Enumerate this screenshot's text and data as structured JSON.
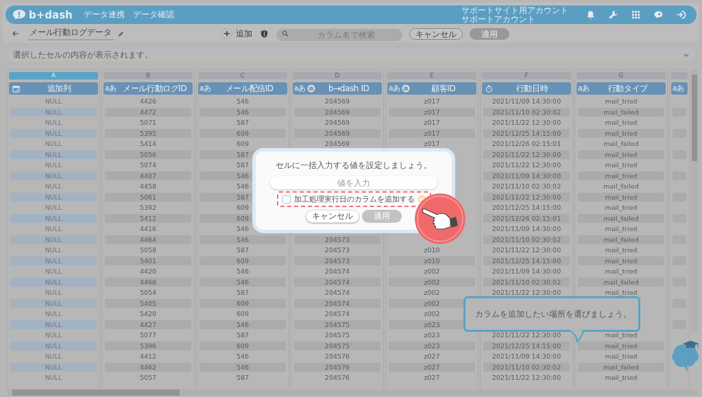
{
  "header": {
    "logo": "b+dash",
    "nav": [
      {
        "label": "データ連携"
      },
      {
        "label": "データ確認"
      }
    ],
    "account": [
      "サポートサイト用アカウント",
      "サポートアカウント"
    ]
  },
  "toolbar": {
    "title": "メール行動ログデータ",
    "add_label": "追加",
    "search": {
      "placeholder": "カラム名で検索"
    },
    "buttons": [
      {
        "label": "キャンセル",
        "disabled": false
      },
      {
        "label": "適用",
        "disabled": true
      }
    ]
  },
  "info_bar": {
    "text": "選択したセルの内容が表示されます。",
    "expanded": false
  },
  "table": {
    "columns": [
      {
        "letter": "A",
        "label": "追加列",
        "kind": "date",
        "selected": true
      },
      {
        "letter": "B",
        "badge": "aあ",
        "label": "メール行動ログID",
        "kind": "text",
        "selected": false
      },
      {
        "letter": "C",
        "badge": "aあ",
        "label": "メール配信ID",
        "kind": "text",
        "selected": false
      },
      {
        "letter": "D",
        "badge": "aあ",
        "label": "b→dash ID",
        "kind": "id",
        "selected": false
      },
      {
        "letter": "E",
        "badge": "aあ",
        "label": "顧客ID",
        "kind": "id",
        "selected": false
      },
      {
        "letter": "F",
        "label": "行動日時",
        "kind": "time",
        "selected": false
      },
      {
        "letter": "G",
        "badge": "aあ",
        "label": "行動タイプ",
        "kind": "text",
        "selected": false
      },
      {
        "badge": "aあ",
        "kind": "text",
        "selected": false
      }
    ],
    "rows": [
      {
        "added": "NULL",
        "log_id": "4426",
        "delivery_id": "546",
        "bdash_id": "204569",
        "customer_id": "z017",
        "acted_at": "2021/11/09 14:30:00",
        "action_type": "mail_tried"
      },
      {
        "added": "NULL",
        "log_id": "4472",
        "delivery_id": "546",
        "bdash_id": "204569",
        "customer_id": "z017",
        "acted_at": "2021/11/10 02:30:02",
        "action_type": "mail_failed"
      },
      {
        "added": "NULL",
        "log_id": "5071",
        "delivery_id": "587",
        "bdash_id": "204569",
        "customer_id": "z017",
        "acted_at": "2021/11/22 12:30:00",
        "action_type": "mail_tried"
      },
      {
        "added": "NULL",
        "log_id": "5395",
        "delivery_id": "609",
        "bdash_id": "204569",
        "customer_id": "z017",
        "acted_at": "2021/12/25 14:15:00",
        "action_type": "mail_tried"
      },
      {
        "added": "NULL",
        "log_id": "5414",
        "delivery_id": "609",
        "bdash_id": "204569",
        "customer_id": "z017",
        "acted_at": "2021/12/26 02:15:01",
        "action_type": "mail_failed"
      },
      {
        "added": "NULL",
        "log_id": "5056",
        "delivery_id": "587",
        "acted_at": "2021/11/22 12:30:00",
        "action_type": "mail_tried"
      },
      {
        "added": "NULL",
        "log_id": "5074",
        "delivery_id": "587",
        "acted_at": "2021/11/22 12:30:00",
        "action_type": "mail_tried"
      },
      {
        "added": "NULL",
        "log_id": "4407",
        "delivery_id": "546",
        "acted_at": "2021/11/09 14:30:00",
        "action_type": "mail_tried"
      },
      {
        "added": "NULL",
        "log_id": "4458",
        "delivery_id": "546",
        "acted_at": "2021/11/10 02:30:02",
        "action_type": "mail_failed"
      },
      {
        "added": "NULL",
        "log_id": "5061",
        "delivery_id": "587",
        "acted_at": "2021/11/22 12:30:00",
        "action_type": "mail_tried"
      },
      {
        "added": "NULL",
        "log_id": "5392",
        "delivery_id": "609",
        "acted_at": "2021/12/25 14:15:00",
        "action_type": "mail_tried"
      },
      {
        "added": "NULL",
        "log_id": "5412",
        "delivery_id": "609",
        "acted_at": "2021/12/26 02:15:01",
        "action_type": "mail_failed"
      },
      {
        "added": "NULL",
        "log_id": "4416",
        "delivery_id": "546",
        "acted_at": "2021/11/09 14:30:00",
        "action_type": "mail_tried"
      },
      {
        "added": "NULL",
        "log_id": "4464",
        "delivery_id": "546",
        "bdash_id": "204573",
        "acted_at": "2021/11/10 02:30:02",
        "action_type": "mail_failed"
      },
      {
        "added": "NULL",
        "log_id": "5058",
        "delivery_id": "587",
        "bdash_id": "204573",
        "customer_id": "z010",
        "acted_at": "2021/11/22 12:30:00",
        "action_type": "mail_tried"
      },
      {
        "added": "NULL",
        "log_id": "5401",
        "delivery_id": "609",
        "bdash_id": "204573",
        "customer_id": "z010",
        "acted_at": "2021/12/25 14:15:00",
        "action_type": "mail_tried"
      },
      {
        "added": "NULL",
        "log_id": "4420",
        "delivery_id": "546",
        "bdash_id": "204574",
        "customer_id": "z002",
        "acted_at": "2021/11/09 14:30:00",
        "action_type": "mail_tried"
      },
      {
        "added": "NULL",
        "log_id": "4468",
        "delivery_id": "546",
        "bdash_id": "204574",
        "customer_id": "z002",
        "acted_at": "2021/11/10 02:30:02",
        "action_type": "mail_failed"
      },
      {
        "added": "NULL",
        "log_id": "5054",
        "delivery_id": "587",
        "bdash_id": "204574",
        "customer_id": "z002",
        "acted_at": "2021/11/22 12:30:00",
        "action_type": "mail_tried"
      },
      {
        "added": "NULL",
        "log_id": "5405",
        "delivery_id": "609",
        "bdash_id": "204574",
        "customer_id": "z002"
      },
      {
        "added": "NULL",
        "log_id": "5420",
        "delivery_id": "609",
        "bdash_id": "204574",
        "customer_id": "z002"
      },
      {
        "added": "NULL",
        "log_id": "4427",
        "delivery_id": "546",
        "bdash_id": "204575",
        "customer_id": "z023"
      },
      {
        "added": "NULL",
        "log_id": "5077",
        "delivery_id": "587",
        "bdash_id": "204575",
        "customer_id": "z023",
        "acted_at": "2021/11/22 12:30:00",
        "action_type": "mail_tried"
      },
      {
        "added": "NULL",
        "log_id": "5396",
        "delivery_id": "609",
        "bdash_id": "204575",
        "customer_id": "z023",
        "acted_at": "2021/12/25 14:15:00",
        "action_type": "mail_tried"
      },
      {
        "added": "NULL",
        "log_id": "4412",
        "delivery_id": "546",
        "bdash_id": "204576",
        "customer_id": "z027",
        "acted_at": "2021/11/09 14:30:00",
        "action_type": "mail_tried"
      },
      {
        "added": "NULL",
        "log_id": "4462",
        "delivery_id": "546",
        "bdash_id": "204576",
        "customer_id": "z027",
        "acted_at": "2021/11/10 02:30:02",
        "action_type": "mail_failed"
      },
      {
        "added": "NULL",
        "log_id": "5057",
        "delivery_id": "587",
        "bdash_id": "204576",
        "customer_id": "z027",
        "acted_at": "2021/11/22 12:30:00",
        "action_type": "mail_tried"
      }
    ]
  },
  "modal": {
    "title": "セルに一括入力する値を設定しましょう。",
    "input": {
      "placeholder": "値を入力"
    },
    "checkbox": {
      "label": "加工処理実行日のカラムを追加する",
      "checked": false,
      "highlighted": true
    },
    "buttons": [
      {
        "label": "キャンセル",
        "disabled": false
      },
      {
        "label": "適用",
        "disabled": true
      }
    ]
  },
  "tooltip": {
    "text": "カラムを追加したい場所を選びましょう。"
  }
}
